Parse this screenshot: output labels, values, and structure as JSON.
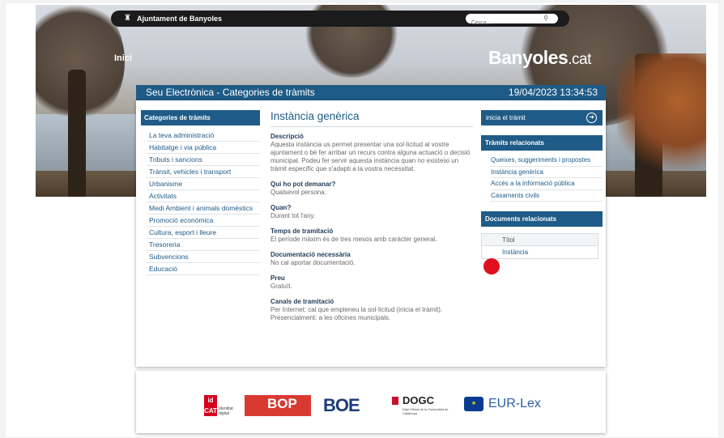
{
  "header": {
    "org_name": "Ajuntament de Banyoles",
    "search_placeholder": "Cerca...",
    "nav_home": "Inici",
    "brand_main": "Banyoles",
    "brand_suffix": ".cat"
  },
  "title_bar": {
    "title": "Seu Electrònica - Categories de tràmits",
    "datetime": "19/04/2023 13:34:53"
  },
  "sidebar": {
    "heading": "Categories de tràmits",
    "items": [
      "La teva administració",
      "Habitatge i via pública",
      "Tributs i sancions",
      "Trànsit, vehicles i transport",
      "Urbanisme",
      "Activitats",
      "Medi Ambient i animals domèstics",
      "Promoció econòmica",
      "Cultura, esport i lleure",
      "Tresoreria",
      "Subvencions",
      "Educació"
    ]
  },
  "main": {
    "title": "Instància genèrica",
    "sections": [
      {
        "heading": "Descripció",
        "text": "Aquesta instància us permet presentar una sol·licitud al vostre ajuntament o bé fer arribar un recurs contra alguna actuació o decisió municipal. Podeu fer servir aquesta instància quan no existeixi un tràmit específic que s'adapti a la vostra necessitat."
      },
      {
        "heading": "Qui ho pot demanar?",
        "text": "Qualsevol persona."
      },
      {
        "heading": "Quan?",
        "text": "Durant tot l'any."
      },
      {
        "heading": "Temps de tramitació",
        "text": "El període màxim és de tres mesos amb caràcter general."
      },
      {
        "heading": "Documentació necessària",
        "text": "No cal aportar documentació."
      },
      {
        "heading": "Preu",
        "text": "Gratuït."
      },
      {
        "heading": "Canals de tramitació",
        "text": "Per Internet: cal que empleneu la sol·licitud (inicia el tràmit). Presencialment: a les oficines municipals."
      }
    ]
  },
  "right": {
    "start_button": "inicia el tràmit",
    "related_heading": "Tràmits relacionats",
    "related_items": [
      "Queixes, suggeriments i propostes",
      "Instància genèrica",
      "Accés a la informació pública",
      "Casaments civils"
    ],
    "docs_heading": "Documents relacionats",
    "docs_column": "Títol",
    "docs_rows": [
      "Instància"
    ]
  },
  "footer": {
    "idcat": "id CAT",
    "idcat_sub": "Identitat digital",
    "bop": "BOP",
    "boe": "BOE",
    "dogc": "DOGC",
    "dogc_sub": "Diari Oficial de la Generalitat de Catalunya",
    "eurlex": "EUR-Lex"
  },
  "colors": {
    "primary": "#1f5b87",
    "marker": "#e0101f"
  }
}
